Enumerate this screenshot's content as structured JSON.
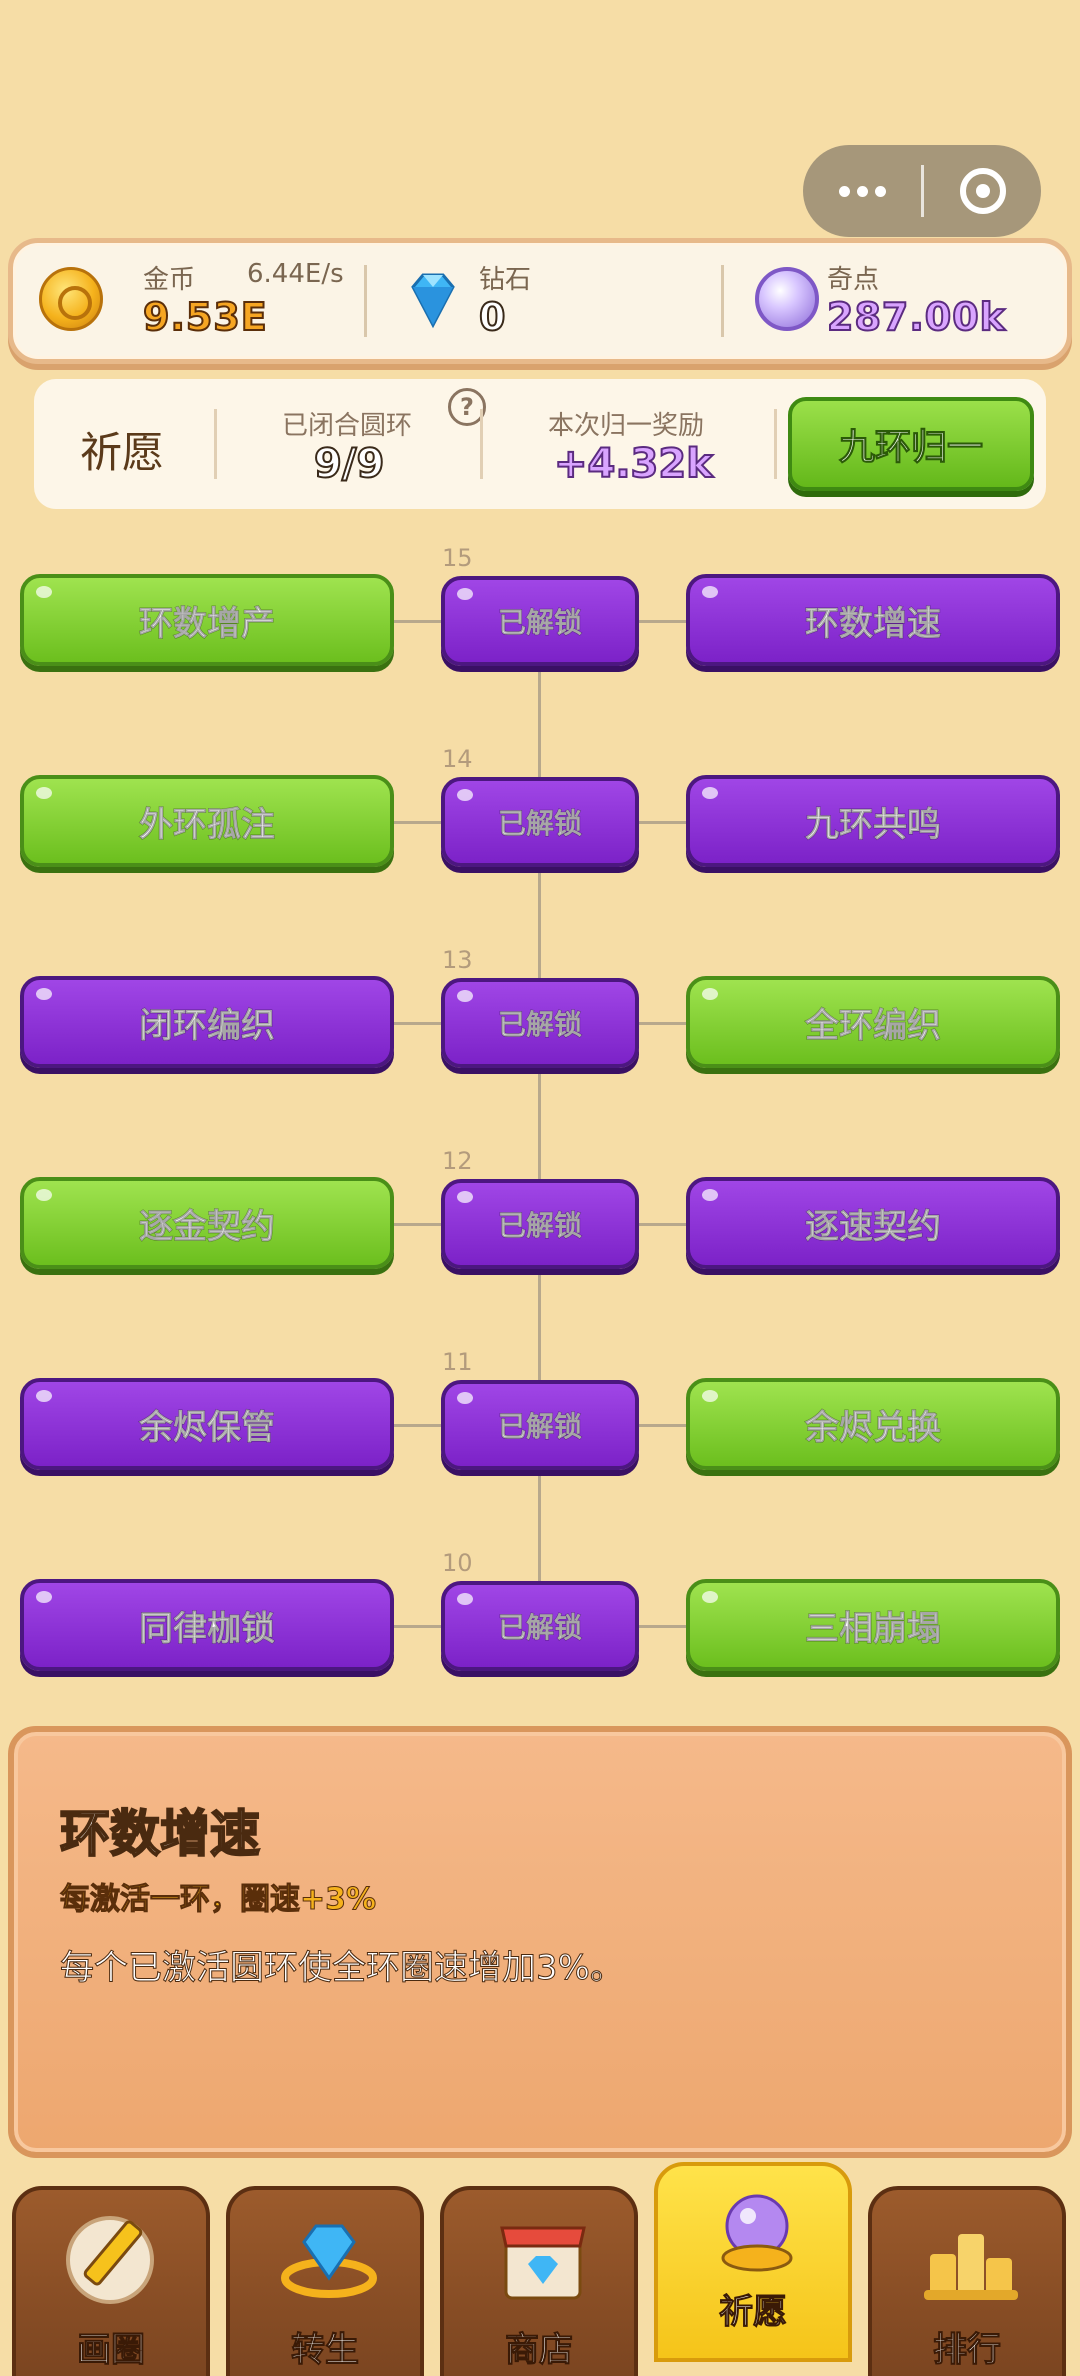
{
  "resources": {
    "coin": {
      "label": "金币",
      "value": "9.53E",
      "rate": "6.44E/s"
    },
    "diamond": {
      "label": "钻石",
      "value": "0"
    },
    "wonder": {
      "label": "奇点",
      "value": "287.00k"
    }
  },
  "wish": {
    "title": "祈愿",
    "closed_label": "已闭合圆环",
    "closed_value": "9/9",
    "reward_label": "本次归一奖励",
    "reward_value": "+4.32k",
    "merge_button": "九环归一"
  },
  "tree": {
    "rows": [
      {
        "level": "15",
        "left": "环数增产",
        "center": "已解锁",
        "right": "环数增速"
      },
      {
        "level": "14",
        "left": "外环孤注",
        "center": "已解锁",
        "right": "九环共鸣"
      },
      {
        "level": "13",
        "left": "闭环编织",
        "center": "已解锁",
        "right": "全环编织"
      },
      {
        "level": "12",
        "left": "逐金契约",
        "center": "已解锁",
        "right": "逐速契约"
      },
      {
        "level": "11",
        "left": "余烬保管",
        "center": "已解锁",
        "right": "余烬兑换"
      },
      {
        "level": "10",
        "left": "同律枷锁",
        "center": "已解锁",
        "right": "三相崩塌"
      }
    ]
  },
  "detail": {
    "title": "环数增速",
    "subtitle": "每激活一环，圈速+3%",
    "body": "每个已激活圆环使全环圈速增加3%。"
  },
  "nav": {
    "tabs": [
      {
        "label": "画圈",
        "icon": "pencil-icon"
      },
      {
        "label": "转生",
        "icon": "gem-ring-icon"
      },
      {
        "label": "商店",
        "icon": "shop-icon"
      },
      {
        "label": "祈愿",
        "icon": "crystal-orb-icon"
      },
      {
        "label": "排行",
        "icon": "podium-icon"
      }
    ]
  },
  "colors": {
    "background": "#f6dda6",
    "green_node": "#6cbf1e",
    "purple_node": "#7c22c8",
    "active_tab": "#f5c419"
  }
}
